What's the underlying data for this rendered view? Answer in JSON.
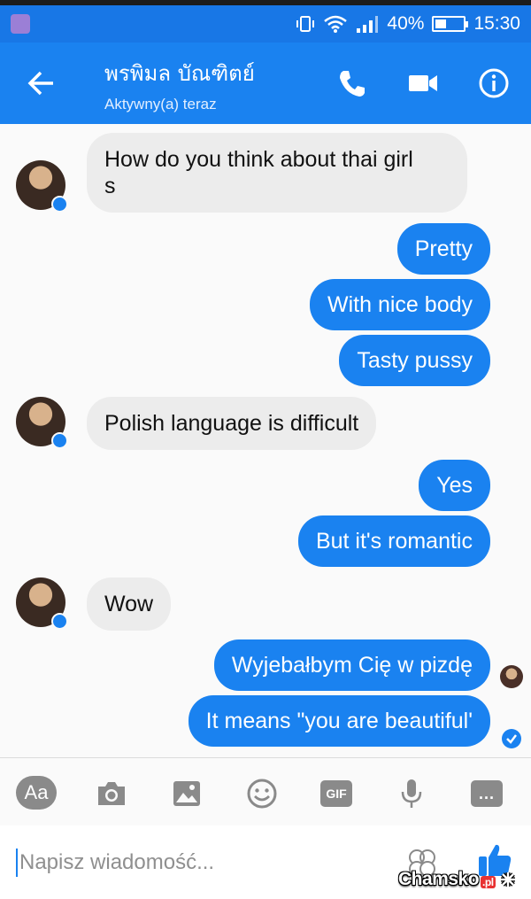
{
  "status_bar": {
    "battery": "40%",
    "battery_level": 0.4,
    "time": "15:30",
    "icons": [
      "app-notification-icon",
      "vibrate-icon",
      "wifi-icon",
      "signal-icon",
      "battery-icon"
    ]
  },
  "header": {
    "contact_name": "พรพิมล บัณฑิตย์",
    "contact_status": "Aktywny(a) teraz",
    "icons": [
      "back-arrow-icon",
      "phone-icon",
      "video-camera-icon",
      "info-icon"
    ]
  },
  "messages": [
    {
      "from": "contact",
      "lines": [
        "How do you think about thai girl",
        "s"
      ]
    },
    {
      "from": "me",
      "text": "Pretty"
    },
    {
      "from": "me",
      "text": "With nice body"
    },
    {
      "from": "me",
      "text": "Tasty pussy"
    },
    {
      "from": "contact",
      "text": "Polish language is difficult"
    },
    {
      "from": "me",
      "text": "Yes"
    },
    {
      "from": "me",
      "text": "But it's romantic"
    },
    {
      "from": "contact",
      "text": "Wow"
    },
    {
      "from": "me",
      "text": "Wyjebałbym Cię w pizdę"
    },
    {
      "from": "me",
      "text": "It means \"you are beautiful'"
    }
  ],
  "composer": {
    "aa_label": "Aa",
    "gif_label": "GIF",
    "more_label": "...",
    "placeholder": "Napisz wiadomość...",
    "icons": [
      "camera-icon",
      "gallery-icon",
      "emoji-icon",
      "microphone-icon",
      "stickers-icon",
      "thumbs-up-icon"
    ]
  },
  "watermark": {
    "text": "Chamsko",
    "suffix": ".pl"
  },
  "colors": {
    "brand_blue": "#1a82f0",
    "status_blue": "#1877e6",
    "incoming_bubble": "#ececec",
    "icon_gray": "#8a8a8a"
  }
}
